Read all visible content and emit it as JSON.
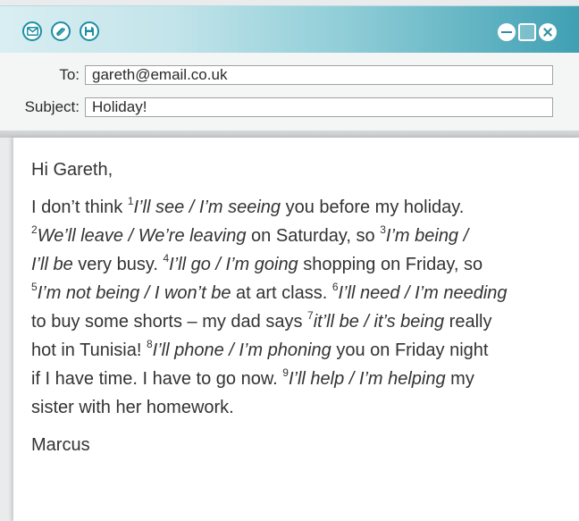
{
  "toolbar": {
    "icons": [
      "envelope-icon",
      "paperclip-icon",
      "save-icon"
    ]
  },
  "window_controls": [
    "minimize-icon",
    "maximize-icon",
    "close-icon"
  ],
  "header": {
    "to_label": "To:",
    "to_value": "gareth@email.co.uk",
    "subject_label": "Subject:",
    "subject_value": "Holiday!"
  },
  "email": {
    "greeting": "Hi Gareth,",
    "signature": "Marcus",
    "lines": [
      [
        {
          "t": "I don’t think "
        },
        {
          "sup": "1"
        },
        {
          "opt": "I’ll see / I’m seeing"
        },
        {
          "t": " you before my holiday."
        }
      ],
      [
        {
          "sup": "2"
        },
        {
          "opt": "We’ll leave / We’re leaving"
        },
        {
          "t": " on Saturday, so "
        },
        {
          "sup": "3"
        },
        {
          "opt": "I’m being /"
        }
      ],
      [
        {
          "opt": "I’ll be"
        },
        {
          "t": " very busy. "
        },
        {
          "sup": "4"
        },
        {
          "opt": "I’ll go / I’m going"
        },
        {
          "t": " shopping on Friday, so"
        }
      ],
      [
        {
          "sup": "5"
        },
        {
          "opt": "I’m not being / I won’t be"
        },
        {
          "t": " at art class. "
        },
        {
          "sup": "6"
        },
        {
          "opt": "I’ll need / I’m needing"
        }
      ],
      [
        {
          "t": "to buy some shorts – my dad says "
        },
        {
          "sup": "7"
        },
        {
          "opt": "it’ll be / it’s being"
        },
        {
          "t": " really"
        }
      ],
      [
        {
          "t": "hot in Tunisia! "
        },
        {
          "sup": "8"
        },
        {
          "opt": "I’ll phone / I’m phoning"
        },
        {
          "t": " you on Friday night"
        }
      ],
      [
        {
          "t": "if I have time. I have to go now. "
        },
        {
          "sup": "9"
        },
        {
          "opt": "I’ll help / I’m helping"
        },
        {
          "t": " my"
        }
      ],
      [
        {
          "t": "sister with her homework."
        }
      ]
    ]
  }
}
